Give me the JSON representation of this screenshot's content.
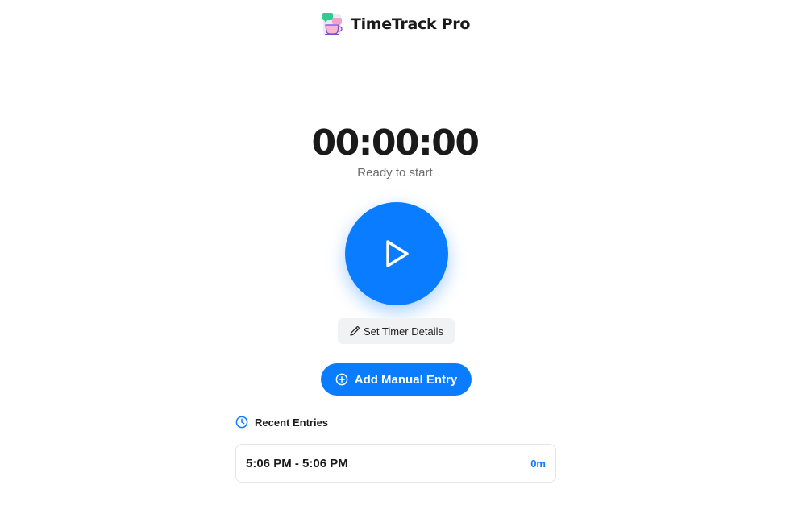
{
  "header": {
    "title": "TimeTrack Pro",
    "logo_icon": "coffee-cup-logo-icon"
  },
  "timer": {
    "display": "00:00:00",
    "status": "Ready to start",
    "play_icon": "play-icon"
  },
  "actions": {
    "details_label": "Set Timer Details",
    "details_icon": "pencil-icon",
    "manual_label": "Add Manual Entry",
    "manual_icon": "plus-circle-icon"
  },
  "recent": {
    "heading": "Recent Entries",
    "heading_icon": "clock-icon",
    "entries": [
      {
        "time_range": "5:06 PM - 5:06 PM",
        "duration": "0m"
      }
    ]
  },
  "colors": {
    "accent": "#0a7cff",
    "text": "#1a1a1a",
    "muted": "#6b6b6b",
    "chip_bg": "#f1f2f4"
  }
}
